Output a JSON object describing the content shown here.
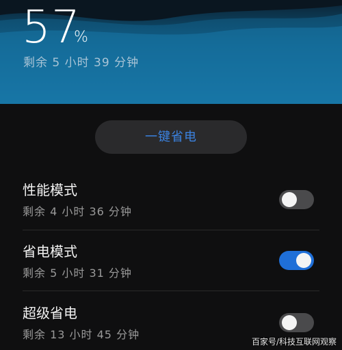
{
  "battery": {
    "percent": "57",
    "percent_sign": "%",
    "remaining": "剩余 5 小时 39 分钟"
  },
  "one_key_button": {
    "label": "一键省电"
  },
  "modes": [
    {
      "title": "性能模式",
      "subtitle": "剩余 4 小时 36 分钟",
      "enabled": false
    },
    {
      "title": "省电模式",
      "subtitle": "剩余 5 小时 31 分钟",
      "enabled": true
    },
    {
      "title": "超级省电",
      "subtitle": "剩余 13 小时 45 分钟",
      "enabled": false
    }
  ],
  "watermark": "百家号/科技互联网观察",
  "colors": {
    "accent": "#1f6fd8",
    "button_text": "#3b82e0",
    "header_top": "#0b2233",
    "header_bottom": "#1b82b5"
  }
}
